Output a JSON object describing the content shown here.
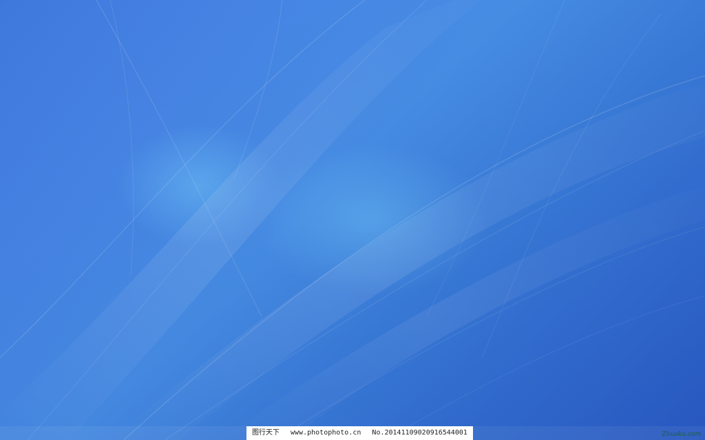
{
  "wallpaper": {
    "colors": {
      "base_top_left": "#3f78dc",
      "base_center": "#4d98ec",
      "base_bottom_right": "#2f64cc",
      "highlight": "#6cc4ff",
      "streak": "#ffffff"
    }
  },
  "watermark": {
    "site_name": "图行天下",
    "url": "www.photophoto.cn",
    "number": "No.20141109020916544001",
    "logo_text": "Zhuoku.com"
  }
}
